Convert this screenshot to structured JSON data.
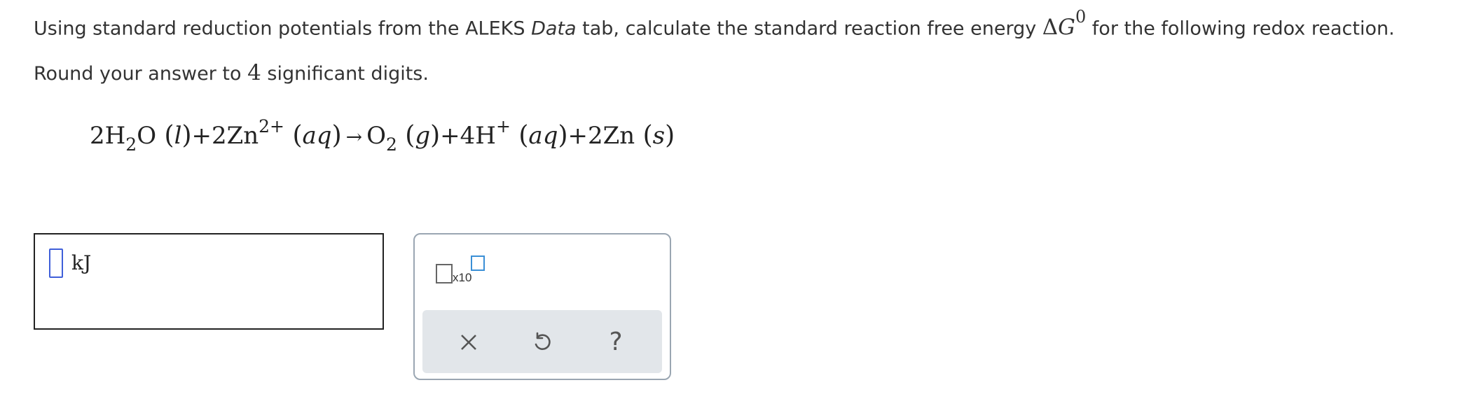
{
  "question": {
    "text_before": "Using standard reduction potentials from the ALEKS ",
    "italic_word": "Data",
    "text_middle": " tab, calculate the standard reaction free energy ",
    "delta_symbol": "Δ",
    "g_symbol": "G",
    "g_superscript": "0",
    "text_after": " for the following redox reaction.",
    "round_before": "Round your answer to ",
    "round_number": "4",
    "round_after": " significant digits."
  },
  "equation": {
    "r1_coef": "2H",
    "r1_sub": "2",
    "r1_tail": "O",
    "r1_phase": "l",
    "plus": "+",
    "r2_coef": "2Zn",
    "r2_charge": "2+",
    "r2_phase": "aq",
    "arrow": "→",
    "p1_coef": "O",
    "p1_sub": "2",
    "p1_phase": "g",
    "p2_coef": "4H",
    "p2_charge": "+",
    "p2_phase": "aq",
    "p3_coef": "2Zn",
    "p3_phase": "s"
  },
  "answer": {
    "value": "",
    "unit": "kJ"
  },
  "tools": {
    "x10_label": "x10",
    "icons": [
      "clear-icon",
      "undo-icon",
      "help-icon"
    ],
    "help_glyph": "?"
  },
  "colors": {
    "input_border": "#3f5fd9",
    "exponent_box": "#3a8fd6",
    "action_bar": "#e2e6ea"
  }
}
